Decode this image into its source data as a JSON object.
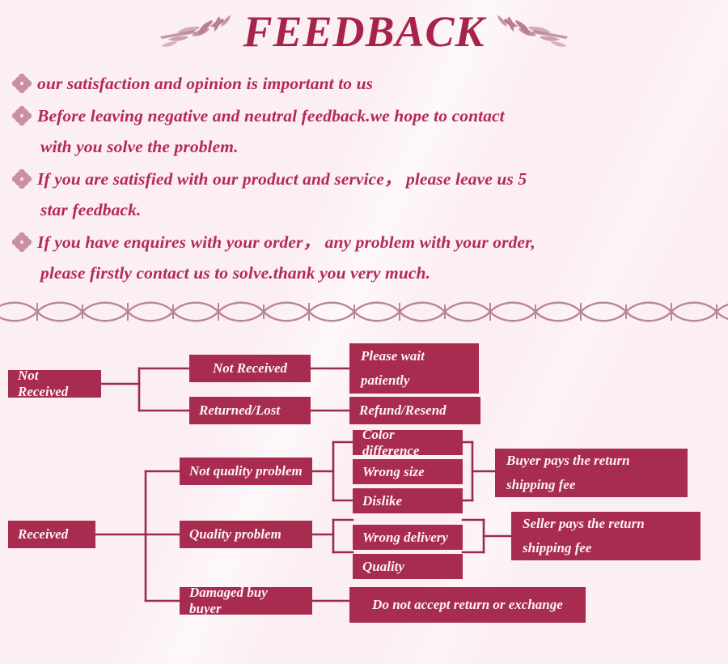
{
  "header": {
    "title": "FEEDBACK",
    "left_ornament": "leaf-sprig-icon",
    "right_ornament": "leaf-sprig-icon"
  },
  "notes": {
    "bullet_icon": "flower-bullet-icon",
    "items": [
      {
        "lines": [
          "our satisfaction and opinion is important to us"
        ]
      },
      {
        "lines": [
          "Before leaving negative and neutral feedback.we hope to contact",
          "with you solve the problem."
        ]
      },
      {
        "lines": [
          "If you are satisfied with our product and service，  please leave us 5",
          "star feedback."
        ]
      },
      {
        "lines": [
          "If you have enquires with your order，  any problem with your order,",
          "please firstly contact us to solve.thank you very much."
        ]
      }
    ]
  },
  "divider": {
    "icon": "wave-ribbon-divider"
  },
  "flowchart": {
    "nodes": {
      "not_received_root": "Not Received",
      "not_received_child": "Not Received",
      "returned_lost": "Returned/Lost",
      "please_wait": "Please wait patiently",
      "refund_resend": "Refund/Resend",
      "received_root": "Received",
      "not_quality_problem": "Not quality problem",
      "color_difference": "Color difference",
      "wrong_size": "Wrong size",
      "dislike": "Dislike",
      "buyer_pays": "Buyer pays the return shipping fee",
      "quality_problem": "Quality problem",
      "wrong_delivery": "Wrong delivery",
      "quality": "Quality",
      "seller_pays": "Seller pays the return shipping fee",
      "damaged_buy_buyer": "Damaged buy buyer",
      "no_return": "Do not accept return or exchange"
    }
  },
  "colors": {
    "background": "#fceff3",
    "accent_deep": "#a8234a",
    "node_fill": "#a82b50",
    "text_rose": "#b4295a",
    "line": "#9c2a4e",
    "ornament": "#b97f93"
  }
}
